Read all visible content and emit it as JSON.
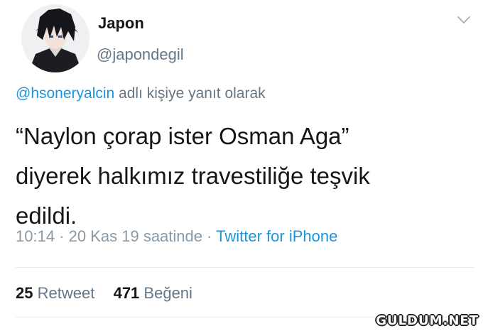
{
  "tweet": {
    "display_name": "Japon",
    "handle": "@japondegil",
    "reply_to_mention": "@hsoneryalcin",
    "reply_to_suffix": " adlı kişiye yanıt olarak",
    "body_lines": [
      "“Naylon çorap ister Osman Aga”",
      "diyerek halkımız travestiliğe teşvik",
      "edildi."
    ],
    "time": "10:14",
    "separator": " · ",
    "date_text": "20 Kas 19 saatinde",
    "source": "Twitter for iPhone",
    "retweet_count": "25",
    "retweet_label": "Retweet",
    "like_count": "471",
    "like_label": "Beğeni"
  },
  "icons": {
    "avatar": "anime-avatar",
    "menu": "chevron-down-icon"
  },
  "colors": {
    "link": "#1b95e0",
    "secondary_text": "#657786",
    "primary_text": "#14171a",
    "divider": "#e6ecf0"
  },
  "watermark": "GULDUM.NET"
}
